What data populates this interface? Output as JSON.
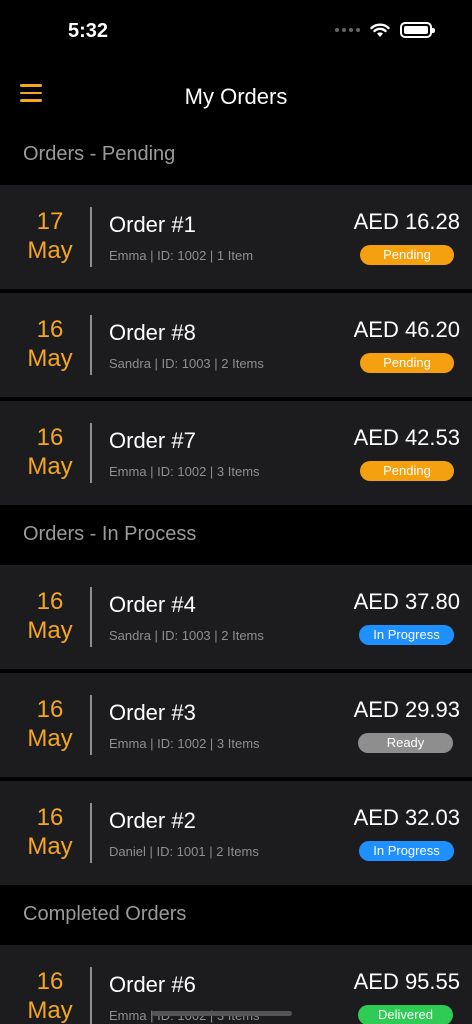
{
  "status_bar": {
    "time": "5:32"
  },
  "nav": {
    "title": "My Orders",
    "menu_icon": "hamburger-icon"
  },
  "colors": {
    "accent": "#f5a623",
    "pending": "#f5a00f",
    "in_progress": "#1e90ff",
    "ready": "#8e8e8e",
    "delivered": "#2ecc55"
  },
  "sections": [
    {
      "title": "Orders - Pending",
      "orders": [
        {
          "day": "17",
          "month": "May",
          "title": "Order #1",
          "meta": "Emma | ID: 1002 | 1 Item",
          "amount": "AED 16.28",
          "status": "Pending"
        },
        {
          "day": "16",
          "month": "May",
          "title": "Order #8",
          "meta": "Sandra | ID: 1003 | 2 Items",
          "amount": "AED 46.20",
          "status": "Pending"
        },
        {
          "day": "16",
          "month": "May",
          "title": "Order #7",
          "meta": "Emma | ID: 1002 | 3 Items",
          "amount": "AED 42.53",
          "status": "Pending"
        }
      ]
    },
    {
      "title": "Orders - In Process",
      "orders": [
        {
          "day": "16",
          "month": "May",
          "title": "Order #4",
          "meta": "Sandra | ID: 1003 | 2 Items",
          "amount": "AED 37.80",
          "status": "In Progress"
        },
        {
          "day": "16",
          "month": "May",
          "title": "Order #3",
          "meta": "Emma | ID: 1002 | 3 Items",
          "amount": "AED 29.93",
          "status": "Ready"
        },
        {
          "day": "16",
          "month": "May",
          "title": "Order #2",
          "meta": "Daniel | ID: 1001 | 2 Items",
          "amount": "AED 32.03",
          "status": "In Progress"
        }
      ]
    },
    {
      "title": "Completed Orders",
      "orders": [
        {
          "day": "16",
          "month": "May",
          "title": "Order #6",
          "meta": "Emma | ID: 1002 | 3 Items",
          "amount": "AED 95.55",
          "status": "Delivered"
        }
      ]
    }
  ]
}
